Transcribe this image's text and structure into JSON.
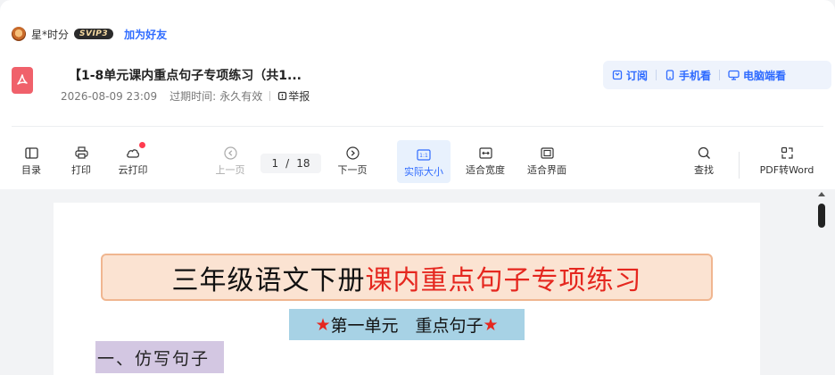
{
  "author": {
    "name": "星*时分",
    "badge": "SVIP3",
    "add_friend": "加为好友"
  },
  "document": {
    "title": "【1-8单元课内重点句子专项练习（共1...",
    "date": "2026-08-09 23:09",
    "expiry_label": "过期时间:",
    "expiry_value": "永久有效",
    "report": "举报"
  },
  "actions": {
    "subscribe": "订阅",
    "mobile_view": "手机看",
    "pc_view": "电脑端看"
  },
  "toolbar": {
    "toc": "目录",
    "print": "打印",
    "cloud_print": "云打印",
    "prev_page": "上一页",
    "current_page": "1",
    "page_sep": "/",
    "total_pages": "18",
    "next_page": "下一页",
    "actual_size": "实际大小",
    "fit_width": "适合宽度",
    "fit_page": "适合界面",
    "search": "查找",
    "pdf_to_word": "PDF转Word"
  },
  "worksheet": {
    "title_black": "三年级语文下册",
    "title_red": "课内重点句子专项练习",
    "unit_star_left": "★",
    "unit_text": "第一单元　重点句子",
    "unit_star_right": "★",
    "section": "一、仿写句子"
  },
  "colors": {
    "accent": "#2f6bff",
    "pdf_red": "#f0616b",
    "title_red": "#e5271f"
  }
}
